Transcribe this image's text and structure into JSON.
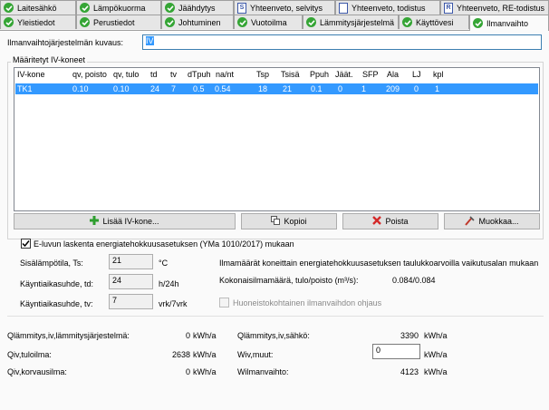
{
  "tabs_row1": [
    {
      "label": "Laitesähkö",
      "icon": "check-icon"
    },
    {
      "label": "Lämpökuorma",
      "icon": "check-icon"
    },
    {
      "label": "Jäähdytys",
      "icon": "check-icon"
    },
    {
      "label": "Yhteenveto, selvitys",
      "icon": "document-icon"
    },
    {
      "label": "Yhteenveto, todistus",
      "icon": "document-icon"
    },
    {
      "label": "Yhteenveto, RE-todistus",
      "icon": "document-icon"
    }
  ],
  "tabs_row2": [
    {
      "label": "Yleistiedot",
      "icon": "check-icon"
    },
    {
      "label": "Perustiedot",
      "icon": "check-icon"
    },
    {
      "label": "Johtuminen",
      "icon": "check-icon"
    },
    {
      "label": "Vuotoilma",
      "icon": "check-icon"
    },
    {
      "label": "Lämmitysjärjestelmä",
      "icon": "check-icon"
    },
    {
      "label": "Käyttövesi",
      "icon": "check-icon"
    },
    {
      "label": "Ilmanvaihto",
      "icon": "check-icon",
      "active": true
    }
  ],
  "description": {
    "label": "Ilmanvaihtojärjestelmän kuvaus:",
    "value": "IV"
  },
  "units_group": {
    "title": "Määritetyt IV-koneet",
    "columns": [
      "IV-kone",
      "qv, poisto",
      "qv, tulo",
      "td",
      "tv",
      "dTpuh",
      "na/nt",
      "Tsp",
      "Tsisä",
      "Ppuh",
      "Jäät.",
      "SFP",
      "Ala",
      "LJ",
      "kpl"
    ],
    "rows": [
      [
        "TK1",
        "0.10",
        "0.10",
        "24",
        "7",
        "0.5",
        "0.54",
        "18",
        "21",
        "0.1",
        "0",
        "1",
        "209",
        "0",
        "1"
      ]
    ]
  },
  "buttons": {
    "add": "Lisää IV-kone...",
    "copy": "Kopioi",
    "delete": "Poista",
    "edit": "Muokkaa..."
  },
  "e_value_checkbox": {
    "label": "E-luvun laskenta energiatehokkuusasetuksen (YMa 1010/2017) mukaan",
    "checked": true
  },
  "settings": {
    "indoor_temp_label": "Sisälämpötila, Ts:",
    "indoor_temp_value": "21",
    "indoor_temp_unit": "°C",
    "usage_day_label": "Käyntiaikasuhde, td:",
    "usage_day_value": "24",
    "usage_day_unit": "h/24h",
    "usage_week_label": "Käyntiaikasuhde, tv:",
    "usage_week_value": "7",
    "usage_week_unit": "vrk/7vrk",
    "info_text": "Ilmamäärät koneittain energiatehokkuusasetuksen taulukkoarvoilla vaikutusalan mukaan",
    "total_air_label": "Kokonaisilmamäärä, tulo/poisto (m³/s):",
    "total_air_value": "0.084/0.084",
    "apartment_label": "Huoneistokohtainen ilmanvaihdon ohjaus",
    "apartment_checked": false
  },
  "results": {
    "q_heat_label": "Qlämmitys,iv,lämmitysjärjestelmä:",
    "q_heat_value": "0",
    "q_heat_unit": "kWh/a",
    "q_supply_label": "Qiv,tuloilma:",
    "q_supply_value": "2638",
    "q_supply_unit": "kWh/a",
    "q_replace_label": "Qiv,korvausilma:",
    "q_replace_value": "0",
    "q_replace_unit": "kWh/a",
    "q_elec_label": "Qlämmitys,iv,sähkö:",
    "q_elec_value": "3390",
    "q_elec_unit": "kWh/a",
    "w_other_label": "Wiv,muut:",
    "w_other_value": "0",
    "w_other_unit": "kWh/a",
    "w_vent_label": "Wilmanvaihto:",
    "w_vent_value": "4123",
    "w_vent_unit": "kWh/a"
  },
  "colors": {
    "selection": "#3399ff",
    "check_green": "#35a535",
    "add_green": "#2e9e2e",
    "delete_red": "#d42a2a",
    "edit_red": "#c0392b"
  }
}
